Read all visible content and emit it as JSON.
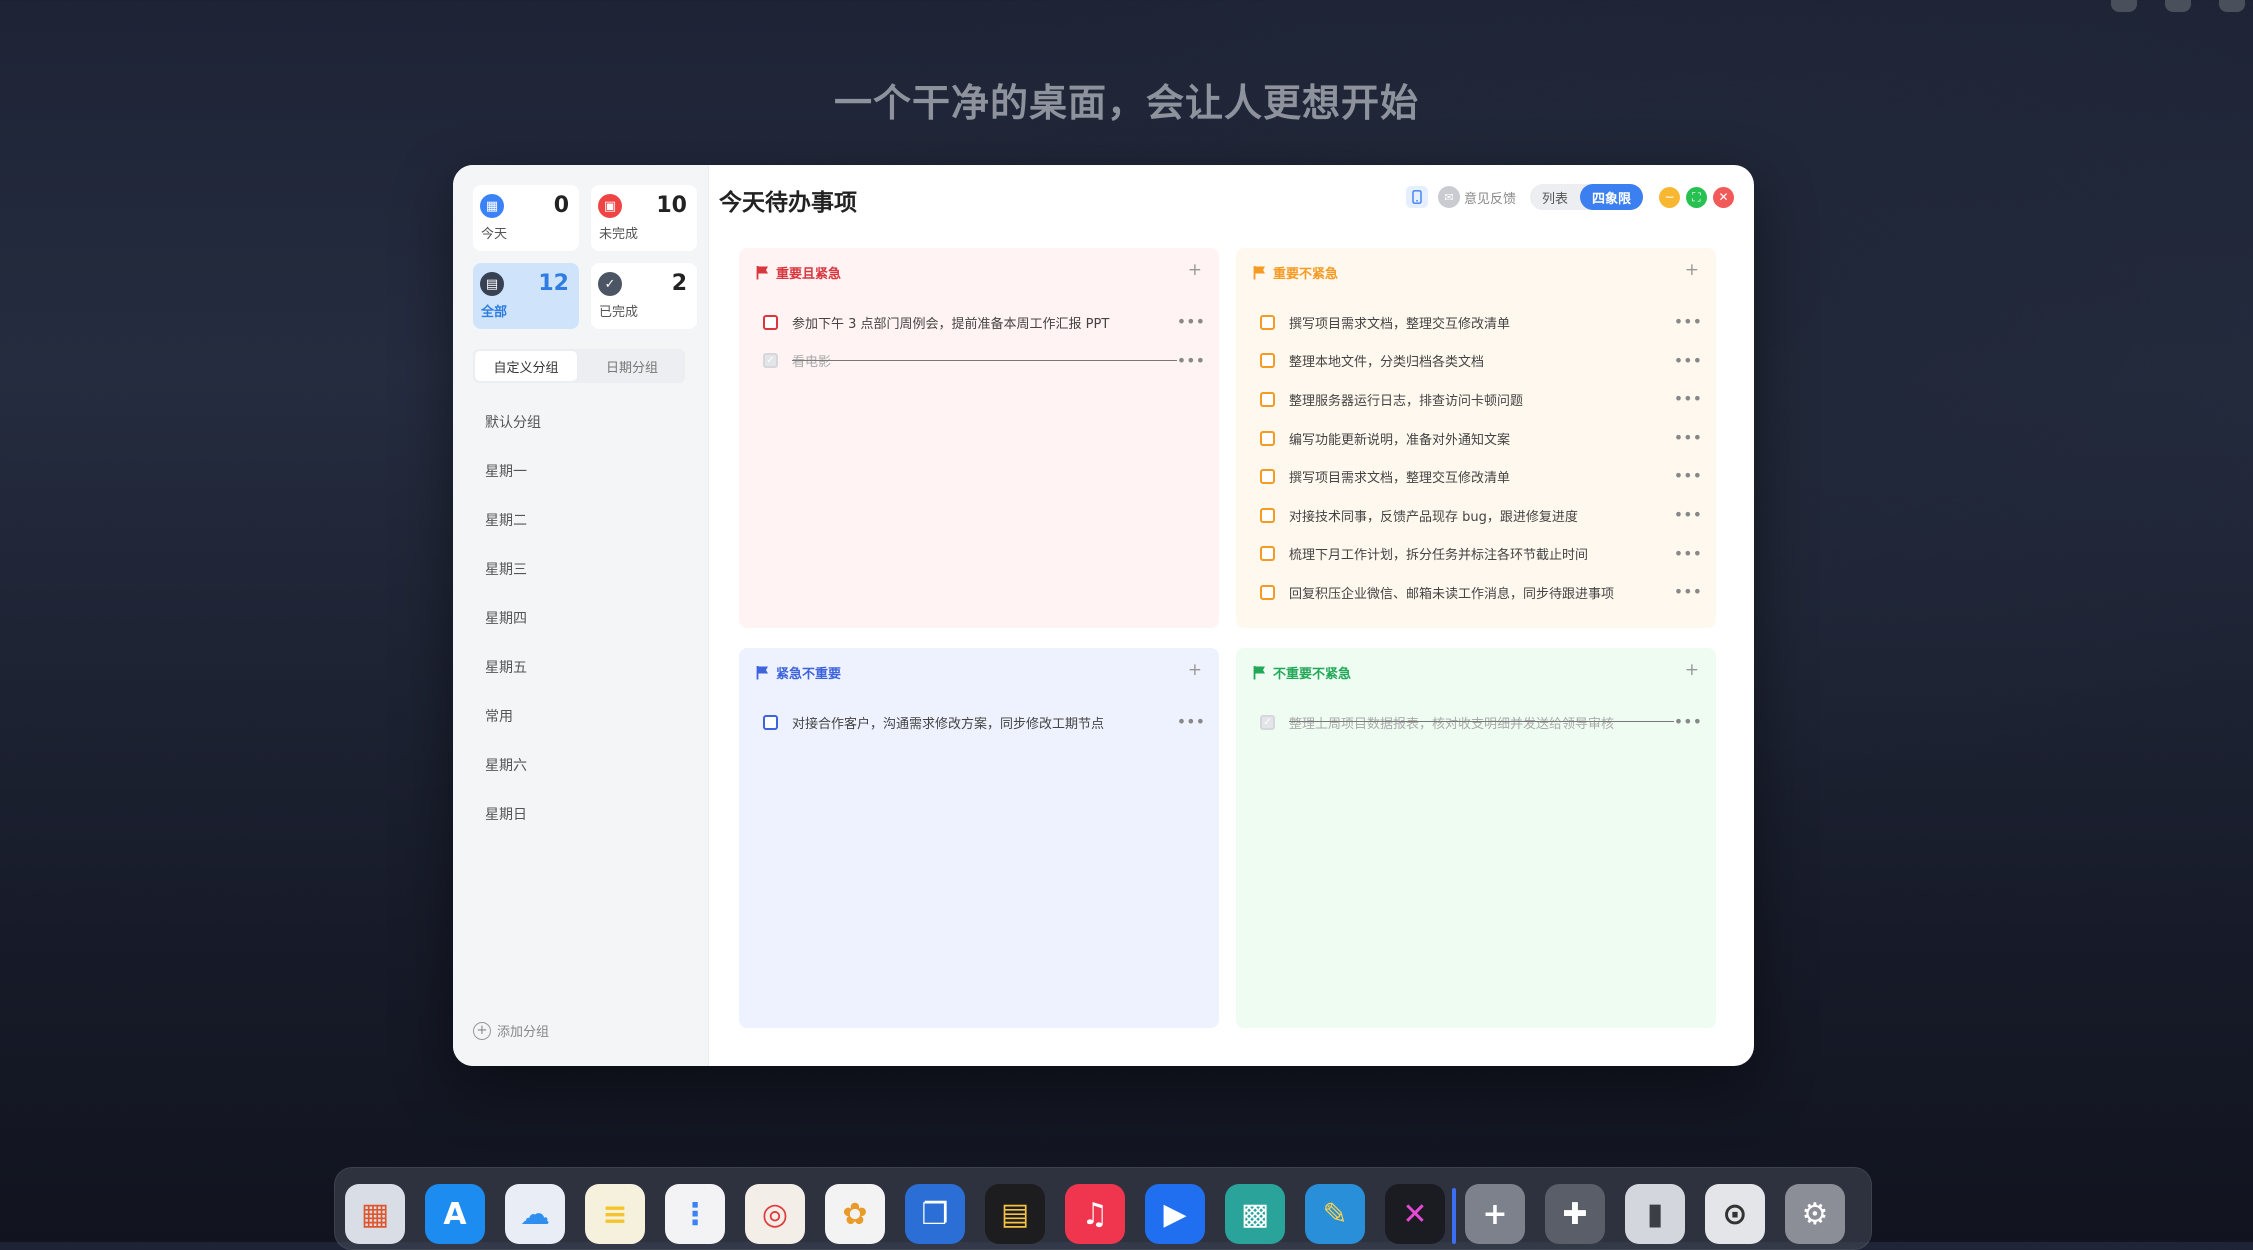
{
  "desktop": {
    "slogan": "一个干净的桌面，会让人更想开始"
  },
  "sidebar": {
    "stats": [
      {
        "label": "今天",
        "count": "0",
        "icon": "today-calendar-icon",
        "color": "#3b82f6",
        "glyph": "▦"
      },
      {
        "label": "未完成",
        "count": "10",
        "icon": "calendar-incomplete-icon",
        "color": "#ef4444",
        "glyph": "▣"
      },
      {
        "label": "全部",
        "count": "12",
        "icon": "inbox-icon",
        "color": "#374151",
        "glyph": "▤"
      },
      {
        "label": "已完成",
        "count": "2",
        "icon": "check-circle-icon",
        "color": "#4b5563",
        "glyph": "✓"
      }
    ],
    "tabs": [
      "自定义分组",
      "日期分组"
    ],
    "groups": [
      "默认分组",
      "星期一",
      "星期二",
      "星期三",
      "星期四",
      "星期五",
      "常用",
      "星期六",
      "星期日"
    ],
    "add_group_label": "添加分组"
  },
  "main": {
    "title": "今天待办事项",
    "feedback_label": "意见反馈",
    "view_modes": [
      "列表",
      "四象限"
    ],
    "active_view": "四象限"
  },
  "quadrants": [
    {
      "title": "重要且紧急",
      "color": "#d9363e",
      "bg": "#fff3f3",
      "tasks": [
        {
          "text": "参加下午 3 点部门周例会，提前准备本周工作汇报 PPT",
          "done": false
        },
        {
          "text": "看电影",
          "done": true
        }
      ]
    },
    {
      "title": "重要不紧急",
      "color": "#f59a23",
      "bg": "#fff8ee",
      "tasks": [
        {
          "text": "撰写项目需求文档，整理交互修改清单",
          "done": false
        },
        {
          "text": "整理本地文件，分类归档各类文档",
          "done": false
        },
        {
          "text": "整理服务器运行日志，排查访问卡顿问题",
          "done": false
        },
        {
          "text": "编写功能更新说明，准备对外通知文案",
          "done": false
        },
        {
          "text": "撰写项目需求文档，整理交互修改清单",
          "done": false
        },
        {
          "text": "对接技术同事，反馈产品现存 bug，跟进修复进度",
          "done": false
        },
        {
          "text": "梳理下月工作计划，拆分任务并标注各环节截止时间",
          "done": false
        },
        {
          "text": "回复积压企业微信、邮箱未读工作消息，同步待跟进事项",
          "done": false
        }
      ]
    },
    {
      "title": "紧急不重要",
      "color": "#3d63dd",
      "bg": "#eef2fe",
      "tasks": [
        {
          "text": "对接合作客户，沟通需求修改方案，同步修改工期节点",
          "done": false
        }
      ]
    },
    {
      "title": "不重要不紧急",
      "color": "#22a858",
      "bg": "#effcf2",
      "tasks": [
        {
          "text": "整理上周项目数据报表，核对收支明细并发送给领导审核",
          "done": true
        }
      ]
    }
  ],
  "dock": {
    "apps": [
      {
        "name": "launchpad-icon",
        "glyph": "▦",
        "bg": "#d8dde6",
        "fg": "#e0562c"
      },
      {
        "name": "app-store-icon",
        "glyph": "A",
        "bg": "#1c8cf0",
        "fg": "#ffffff"
      },
      {
        "name": "icloud-icon",
        "glyph": "☁",
        "bg": "#e9eef6",
        "fg": "#2f8ff0"
      },
      {
        "name": "notes-icon",
        "glyph": "≡",
        "bg": "#f6f1dc",
        "fg": "#f5c42b"
      },
      {
        "name": "reminders-icon",
        "glyph": "⋮",
        "bg": "#f3f3f6",
        "fg": "#3b82f6"
      },
      {
        "name": "calendar-icon",
        "glyph": "◎",
        "bg": "#f4eee8",
        "fg": "#e03c3c"
      },
      {
        "name": "photos-icon",
        "glyph": "✿",
        "bg": "#f3f3f3",
        "fg": "#e89a2b"
      },
      {
        "name": "files-icon",
        "glyph": "❐",
        "bg": "#2b6fd6",
        "fg": "#ffffff"
      },
      {
        "name": "wallet-icon",
        "glyph": "▤",
        "bg": "#1d1d1f",
        "fg": "#f5c342"
      },
      {
        "name": "music-icon",
        "glyph": "♫",
        "bg": "#f0364f",
        "fg": "#ffffff"
      },
      {
        "name": "video-player-icon",
        "glyph": "▶",
        "bg": "#1f6ff0",
        "fg": "#ffffff"
      },
      {
        "name": "qr-code-icon",
        "glyph": "▩",
        "bg": "#2aa39a",
        "fg": "#ffffff"
      },
      {
        "name": "sketch-pencil-icon",
        "glyph": "✎",
        "bg": "#2a8fd9",
        "fg": "#f7d24b"
      },
      {
        "name": "code-editor-icon",
        "glyph": "✕",
        "bg": "#1b1b22",
        "fg": "#e84ad8"
      },
      {
        "name": "add-widget-icon",
        "glyph": "+",
        "bg": "#7d818b",
        "fg": "#ffffff"
      },
      {
        "name": "puzzle-extension-icon",
        "glyph": "✚",
        "bg": "#5a5e68",
        "fg": "#ffffff"
      },
      {
        "name": "brush-icon",
        "glyph": "▮",
        "bg": "#d3d6dc",
        "fg": "#3b3e45"
      },
      {
        "name": "lock-settings-icon",
        "glyph": "⊙",
        "bg": "#e3e5e9",
        "fg": "#333"
      },
      {
        "name": "system-settings-icon",
        "glyph": "⚙",
        "bg": "#8b8e96",
        "fg": "#ffffff"
      }
    ]
  }
}
